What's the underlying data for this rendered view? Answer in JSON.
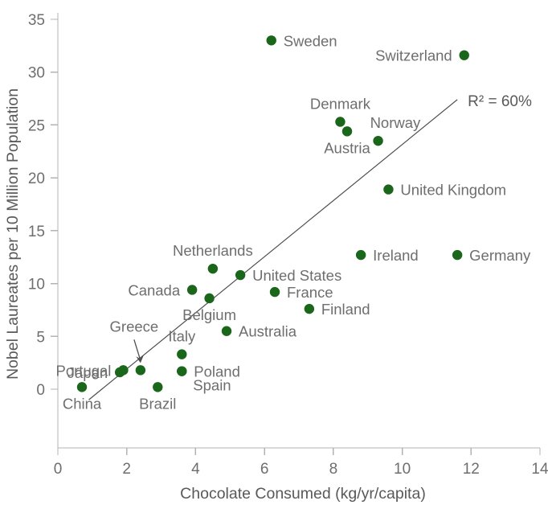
{
  "chart_data": {
    "type": "scatter",
    "title": "",
    "xlabel": "Chocolate Consumed (kg/yr/capita)",
    "ylabel": "Nobel Laureates per 10 Million Population",
    "xlim": [
      0,
      14
    ],
    "ylim": [
      0,
      35
    ],
    "xticks": [
      0,
      2,
      4,
      6,
      8,
      10,
      12,
      14
    ],
    "yticks": [
      0,
      5,
      10,
      15,
      20,
      25,
      30,
      35
    ],
    "xtick_labels": [
      "0",
      "2",
      "4",
      "6",
      "8",
      "10",
      "12",
      "14"
    ],
    "ytick_labels": [
      "0",
      "5",
      "10",
      "15",
      "20",
      "25",
      "30",
      "35"
    ],
    "grid": false,
    "legend": false,
    "point_color": "#1a661a",
    "line_color": "#4d4d4d",
    "text_color": "#6e6e6e",
    "annotation": "R² = 60%",
    "fit_line": {
      "x0": 0.9,
      "y0": -1.0,
      "x1": 11.6,
      "y1": 27.4
    },
    "points": [
      {
        "name": "Sweden",
        "x": 6.2,
        "y": 33.0,
        "label_pos": "right"
      },
      {
        "name": "Switzerland",
        "x": 11.8,
        "y": 31.6,
        "label_pos": "left"
      },
      {
        "name": "Denmark",
        "x": 8.2,
        "y": 25.3,
        "label_pos": "up"
      },
      {
        "name": "Austria",
        "x": 8.4,
        "y": 24.4,
        "label_pos": "down"
      },
      {
        "name": "Norway",
        "x": 9.3,
        "y": 23.5,
        "label_pos": "upright"
      },
      {
        "name": "United Kingdom",
        "x": 9.6,
        "y": 18.9,
        "label_pos": "right"
      },
      {
        "name": "Ireland",
        "x": 8.8,
        "y": 12.7,
        "label_pos": "right"
      },
      {
        "name": "Germany",
        "x": 11.6,
        "y": 12.7,
        "label_pos": "right"
      },
      {
        "name": "Netherlands",
        "x": 4.5,
        "y": 11.4,
        "label_pos": "up"
      },
      {
        "name": "United States",
        "x": 5.3,
        "y": 10.8,
        "label_pos": "right"
      },
      {
        "name": "Canada",
        "x": 3.9,
        "y": 9.4,
        "label_pos": "left"
      },
      {
        "name": "France",
        "x": 6.3,
        "y": 9.2,
        "label_pos": "right"
      },
      {
        "name": "Belgium",
        "x": 4.4,
        "y": 8.6,
        "label_pos": "down"
      },
      {
        "name": "Finland",
        "x": 7.3,
        "y": 7.6,
        "label_pos": "right"
      },
      {
        "name": "Australia",
        "x": 4.9,
        "y": 5.5,
        "label_pos": "right"
      },
      {
        "name": "Italy",
        "x": 3.6,
        "y": 3.3,
        "label_pos": "up"
      },
      {
        "name": "Poland",
        "x": 3.6,
        "y": 1.7,
        "label_pos": "right"
      },
      {
        "name": "Spain",
        "x": 3.6,
        "y": 1.7,
        "label_pos": "downright"
      },
      {
        "name": "Greece",
        "x": 2.4,
        "y": 1.8,
        "label_pos": "arrow"
      },
      {
        "name": "Portugal",
        "x": 1.9,
        "y": 1.8,
        "label_pos": "left"
      },
      {
        "name": "Japan",
        "x": 1.8,
        "y": 1.6,
        "label_pos": "left"
      },
      {
        "name": "China",
        "x": 0.7,
        "y": 0.2,
        "label_pos": "down"
      },
      {
        "name": "Brazil",
        "x": 2.9,
        "y": 0.2,
        "label_pos": "down"
      }
    ]
  }
}
